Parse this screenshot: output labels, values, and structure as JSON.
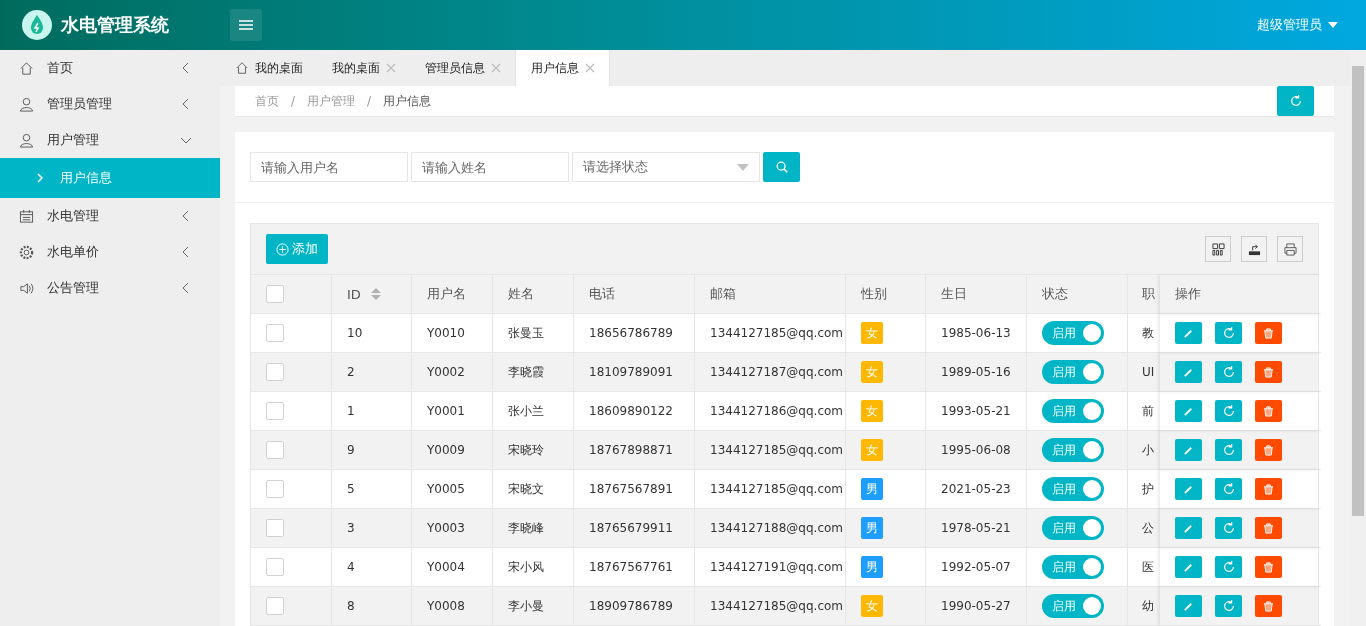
{
  "header": {
    "logo": "水电管理系统",
    "user": "超级管理员"
  },
  "sidebar": {
    "items": [
      {
        "label": "首页",
        "expanded": false
      },
      {
        "label": "管理员管理",
        "expanded": false
      },
      {
        "label": "用户管理",
        "expanded": true,
        "children": [
          {
            "label": "用户信息",
            "selected": true
          }
        ]
      },
      {
        "label": "水电管理",
        "expanded": false
      },
      {
        "label": "水电单价",
        "expanded": false
      },
      {
        "label": "公告管理",
        "expanded": false
      }
    ]
  },
  "tabs": [
    {
      "label": "我的桌面",
      "kind": "home",
      "selected": false
    },
    {
      "label": "我的桌面",
      "kind": "closable",
      "selected": false
    },
    {
      "label": "管理员信息",
      "kind": "closable",
      "selected": false
    },
    {
      "label": "用户信息",
      "kind": "closable",
      "selected": true
    }
  ],
  "breadcrumb": {
    "items": [
      "首页",
      "用户管理",
      "用户信息"
    ],
    "separators": [
      "/",
      "/"
    ]
  },
  "search": {
    "username": {
      "placeholder": "请输入用户名"
    },
    "name": {
      "placeholder": "请输入姓名"
    },
    "status": {
      "placeholder": "请选择状态"
    }
  },
  "toolbar": {
    "add": "添加"
  },
  "table": {
    "select_all_checked": false,
    "columns": [
      "ID",
      "用户名",
      "姓名",
      "电话",
      "邮箱",
      "性别",
      "生日",
      "状态",
      "职",
      "操作"
    ],
    "rows": [
      {
        "checked": false,
        "id": "10",
        "username": "Y0010",
        "name": "张曼玉",
        "phone": "18656786789",
        "email": "1344127185@qq.com",
        "gender": "女",
        "color": "#ffb800",
        "birthday": "1985-06-13",
        "status": "启用",
        "on": true,
        "job": "教"
      },
      {
        "checked": false,
        "id": "2",
        "username": "Y0002",
        "name": "李晓霞",
        "phone": "18109789091",
        "email": "1344127187@qq.com",
        "gender": "女",
        "color": "#ffb800",
        "birthday": "1989-05-16",
        "status": "启用",
        "on": true,
        "job": "UI"
      },
      {
        "checked": false,
        "id": "1",
        "username": "Y0001",
        "name": "张小兰",
        "phone": "18609890122",
        "email": "1344127186@qq.com",
        "gender": "女",
        "color": "#ffb800",
        "birthday": "1993-05-21",
        "status": "启用",
        "on": true,
        "job": "前"
      },
      {
        "checked": false,
        "id": "9",
        "username": "Y0009",
        "name": "宋晓玲",
        "phone": "18767898871",
        "email": "1344127185@qq.com",
        "gender": "女",
        "color": "#ffb800",
        "birthday": "1995-06-08",
        "status": "启用",
        "on": true,
        "job": "小"
      },
      {
        "checked": false,
        "id": "5",
        "username": "Y0005",
        "name": "宋晓文",
        "phone": "18767567891",
        "email": "1344127185@qq.com",
        "gender": "男",
        "color": "#1e9fff",
        "birthday": "2021-05-23",
        "status": "启用",
        "on": true,
        "job": "护"
      },
      {
        "checked": false,
        "id": "3",
        "username": "Y0003",
        "name": "李晓峰",
        "phone": "18765679911",
        "email": "1344127188@qq.com",
        "gender": "男",
        "color": "#1e9fff",
        "birthday": "1978-05-21",
        "status": "启用",
        "on": true,
        "job": "公"
      },
      {
        "checked": false,
        "id": "4",
        "username": "Y0004",
        "name": "宋小风",
        "phone": "18767567761",
        "email": "1344127191@qq.com",
        "gender": "男",
        "color": "#1e9fff",
        "birthday": "1992-05-07",
        "status": "启用",
        "on": true,
        "job": "医"
      },
      {
        "checked": false,
        "id": "8",
        "username": "Y0008",
        "name": "李小曼",
        "phone": "18909786789",
        "email": "1344127185@qq.com",
        "gender": "女",
        "color": "#ffb800",
        "birthday": "1990-05-27",
        "status": "启用",
        "on": true,
        "job": "幼"
      }
    ]
  }
}
